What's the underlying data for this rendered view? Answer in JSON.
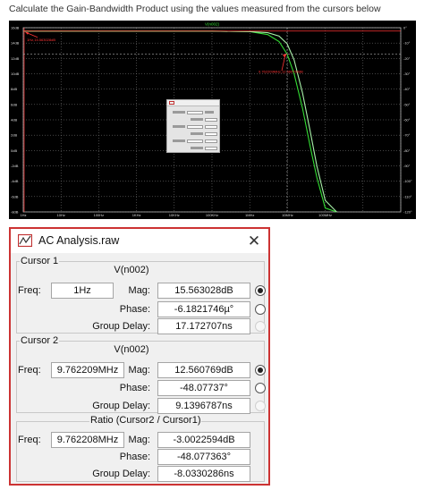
{
  "question": "Calculate the Gain-Bandwidth Product using the values measured from the cursors below",
  "colors": {
    "plot_bg": "#000000",
    "grid": "#888888",
    "curve": "#33dd33",
    "phase_curve": "#a8f0a8",
    "red_cursor": "#ff3333",
    "dialog_border": "#cc3333"
  },
  "chart_data": [
    {
      "type": "line",
      "title": "V(n002)",
      "x_scale": "log",
      "xlim": [
        1,
        10000000000
      ],
      "x_tick_labels": [
        "1Hz",
        "10Hz",
        "100Hz",
        "1KHz",
        "10KHz",
        "100KHz",
        "1MHz",
        "10MHz",
        "100MHz"
      ],
      "ylim_left": [
        -8,
        16
      ],
      "y_tick_labels_left": [
        "16dB",
        "14dB",
        "12dB",
        "10dB",
        "8dB",
        "6dB",
        "4dB",
        "2dB",
        "0dB",
        "-2dB",
        "-4dB",
        "-6dB",
        "-8dB"
      ],
      "ylim_right": [
        -120,
        0
      ],
      "y_tick_labels_right": [
        "0°",
        "-10°",
        "-20°",
        "-30°",
        "-40°",
        "-50°",
        "-60°",
        "-70°",
        "-80°",
        "-90°",
        "-100°",
        "-110°",
        "-120°"
      ],
      "grid": true,
      "series": [
        {
          "name": "V(n002)",
          "x": [
            1,
            10,
            100,
            1000,
            10000,
            100000,
            1000000,
            3000000,
            6000000,
            9762209,
            15000000,
            25000000,
            40000000,
            60000000,
            100000000,
            200000000
          ],
          "y": [
            15.56,
            15.56,
            15.56,
            15.56,
            15.56,
            15.56,
            15.5,
            15.1,
            14.2,
            12.56,
            10.0,
            5.5,
            0.5,
            -3.5,
            -7.5,
            -8
          ]
        },
        {
          "x": [
            1,
            10,
            100,
            1000,
            10000,
            100000,
            1000000,
            3000000,
            6000000,
            9762209,
            15000000,
            25000000,
            40000000,
            60000000,
            100000000,
            200000000
          ],
          "y": [
            15.56,
            15.56,
            15.56,
            15.56,
            15.56,
            15.56,
            15.5,
            15.35,
            14.9,
            13.9,
            11.8,
            7.5,
            2.5,
            -2.0,
            -6.5,
            -8
          ]
        }
      ],
      "annotations": [
        {
          "text": "1Hz,15.563028dB",
          "x": 1,
          "y": 15.563028
        },
        {
          "text": "9.762209MHz,12.560769dB",
          "x": 9762209,
          "y": 12.560769
        }
      ]
    }
  ],
  "dialog": {
    "title": "AC Analysis.raw",
    "close_glyph": "✕",
    "cursor1": {
      "label": "Cursor 1",
      "trace": "V(n002)",
      "freq_label": "Freq:",
      "freq": "1Hz",
      "mag_label": "Mag:",
      "mag": "15.563028dB",
      "phase_label": "Phase:",
      "phase": "-6.1821746µ°",
      "gd_label": "Group Delay:",
      "gd": "17.172707ns"
    },
    "cursor2": {
      "label": "Cursor 2",
      "trace": "V(n002)",
      "freq_label": "Freq:",
      "freq": "9.762209MHz",
      "mag_label": "Mag:",
      "mag": "12.560769dB",
      "phase_label": "Phase:",
      "phase": "-48.07737°",
      "gd_label": "Group Delay:",
      "gd": "9.1396787ns"
    },
    "ratio": {
      "label": "Ratio (Cursor2 / Cursor1)",
      "freq_label": "Freq:",
      "freq": "9.762208MHz",
      "mag_label": "Mag:",
      "mag": "-3.0022594dB",
      "phase_label": "Phase:",
      "phase": "-48.077363°",
      "gd_label": "Group Delay:",
      "gd": "-8.0330286ns"
    }
  }
}
